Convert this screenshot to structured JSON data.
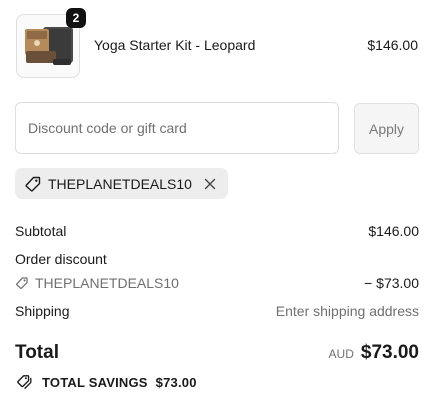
{
  "cart": {
    "items": [
      {
        "quantity": "2",
        "name": "Yoga Starter Kit - Leopard",
        "price": "$146.00",
        "image_icon": "product-thumbnail"
      }
    ]
  },
  "discount": {
    "placeholder": "Discount code or gift card",
    "value": "",
    "apply_label": "Apply",
    "applied_code": "THEPLANETDEALS10",
    "tag_icon": "tag-icon",
    "remove_icon": "close-icon"
  },
  "summary": {
    "subtotal_label": "Subtotal",
    "subtotal_value": "$146.00",
    "order_discount_label": "Order discount",
    "order_discount_code": "THEPLANETDEALS10",
    "order_discount_value": "− $73.00",
    "shipping_label": "Shipping",
    "shipping_value": "Enter shipping address",
    "total_label": "Total",
    "total_currency": "AUD",
    "total_value": "$73.00",
    "savings_label": "TOTAL SAVINGS",
    "savings_value": "$73.00",
    "savings_icon": "tags-icon"
  },
  "colors": {
    "text": "#1a1a1a",
    "muted": "#707070",
    "chip_bg": "#ededed",
    "button_bg": "#f5f5f5",
    "border": "#dedede"
  }
}
